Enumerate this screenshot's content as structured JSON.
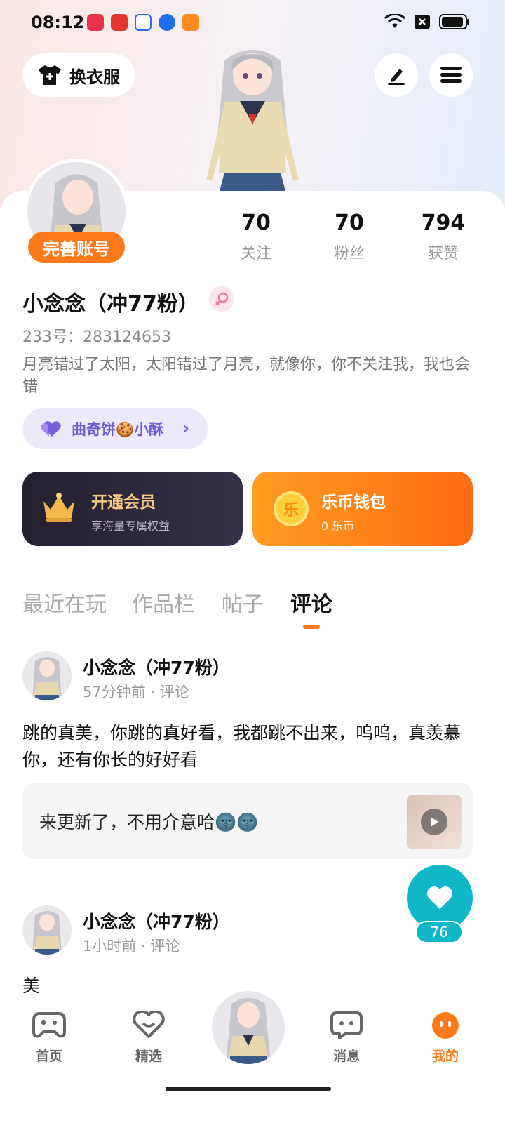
{
  "status_bar": {
    "time": "08:12"
  },
  "header": {
    "dress_up_label": "换衣服",
    "edit_icon": "pencil-icon",
    "menu_icon": "menu-icon"
  },
  "profile": {
    "complete_account_label": "完善账号",
    "stats": [
      {
        "value": "70",
        "label": "关注"
      },
      {
        "value": "70",
        "label": "粉丝"
      },
      {
        "value": "794",
        "label": "获赞"
      }
    ],
    "username": "小念念（冲77粉）",
    "uid": "233号：283124653",
    "bio": "月亮错过了太阳，太阳错过了月亮，就像你，你不关注我，我也会错",
    "fan_chip": "曲奇饼🍪小酥"
  },
  "cards": {
    "vip": {
      "title": "开通会员",
      "subtitle": "享海量专属权益"
    },
    "wallet": {
      "title": "乐币钱包",
      "subtitle": "0 乐币",
      "coin_glyph": "乐"
    }
  },
  "tabs": [
    {
      "label": "最近在玩"
    },
    {
      "label": "作品栏"
    },
    {
      "label": "帖子"
    },
    {
      "label": "评论",
      "active": true
    }
  ],
  "comments": [
    {
      "name": "小念念（冲77粉）",
      "meta": "57分钟前 · 评论",
      "text": "跳的真美，你跳的真好看，我都跳不出来，呜呜，真羡慕你，还有你长的好好看",
      "quote": "来更新了，不用介意哈🌚🌚"
    },
    {
      "name": "小念念（冲77粉）",
      "meta": "1小时前 · 评论",
      "text": "美"
    }
  ],
  "like": {
    "count": "76"
  },
  "bottom_nav": [
    {
      "label": "首页",
      "icon": "gamepad-icon"
    },
    {
      "label": "精选",
      "icon": "heart-smile-icon"
    },
    {
      "label": "消息",
      "icon": "chat-icon"
    },
    {
      "label": "我的",
      "icon": "profile-face-icon",
      "active": true
    }
  ],
  "colors": {
    "accent": "#ff7a1a",
    "like_fab": "#0fb7c8",
    "fan_chip_text": "#6e5bd6",
    "vip_gold": "#f3c983"
  }
}
